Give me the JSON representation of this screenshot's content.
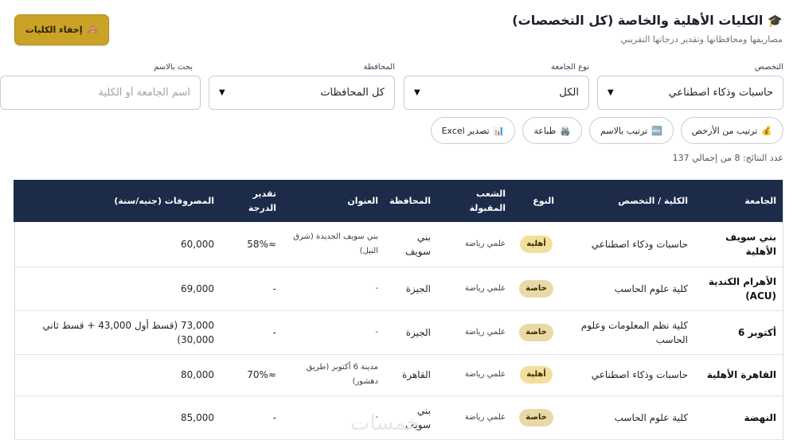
{
  "header": {
    "title": "الكليات الأهلية والخاصة (كل التخصصات)",
    "subtitle": "مصاريفها ومحافظاتها وتقدير درجاتها التقريبي",
    "hide_button": "إخفاء الكليات"
  },
  "filters": {
    "specialty": {
      "label": "التخصص",
      "value": "حاسبات وذكاء اصطناعي"
    },
    "uni_type": {
      "label": "نوع الجامعة",
      "value": "الكل"
    },
    "governorate": {
      "label": "المحافظة",
      "value": "كل المحافظات"
    },
    "search": {
      "label": "بحث بالاسم",
      "placeholder": "اسم الجامعة أو الكلية"
    }
  },
  "actions": {
    "sort_cheapest": "ترتيب من الأرخص",
    "sort_name": "ترتيب بالاسم",
    "print": "طباعة",
    "export": "تصدير Excel"
  },
  "results_count": "عدد النتائج: 8 من إجمالي 137",
  "table": {
    "headers": {
      "university": "الجامعة",
      "college": "الكلية / التخصص",
      "type": "النوع",
      "branches_1": "الشعب",
      "branches_2": "المقبولة",
      "governorate": "المحافظة",
      "address": "العنوان",
      "score_1": "تقدير",
      "score_2": "الدرجة",
      "fees": "المصروفات (جنيه/سنة)"
    },
    "rows": [
      {
        "university": "بني سويف الأهلية",
        "college": "حاسبات وذكاء اصطناعي",
        "type": "أهلية",
        "branches": "علمي رياضة",
        "governorate": "بني سويف",
        "address": "بني سويف الجديدة (شرق النيل)",
        "score": "≈58%",
        "fees": "60,000"
      },
      {
        "university": "الأهرام الكندية (ACU)",
        "college": "كلية علوم الحاسب",
        "type": "خاصة",
        "branches": "علمي رياضة",
        "governorate": "الجيزة",
        "address": "-",
        "score": "-",
        "fees": "69,000"
      },
      {
        "university": "أكتوبر 6",
        "college": "كلية نظم المعلومات وعلوم الحاسب",
        "type": "خاصة",
        "branches": "علمي رياضة",
        "governorate": "الجيزة",
        "address": "-",
        "score": "-",
        "fees": "73,000 (قسط أول 43,000 + قسط ثاني 30,000)"
      },
      {
        "university": "القاهرة الأهلية",
        "college": "حاسبات وذكاء اصطناعي",
        "type": "أهلية",
        "branches": "علمي رياضة",
        "governorate": "القاهرة",
        "address": "مدينة 6 أكتوبر (طريق دهشور)",
        "score": "≈70%",
        "fees": "80,000"
      },
      {
        "university": "النهضة",
        "college": "كلية علوم الحاسب",
        "type": "خاصة",
        "branches": "علمي رياضة",
        "governorate": "بني سويف",
        "address": "-",
        "score": "-",
        "fees": "85,000"
      }
    ]
  },
  "watermark": "خمسات"
}
